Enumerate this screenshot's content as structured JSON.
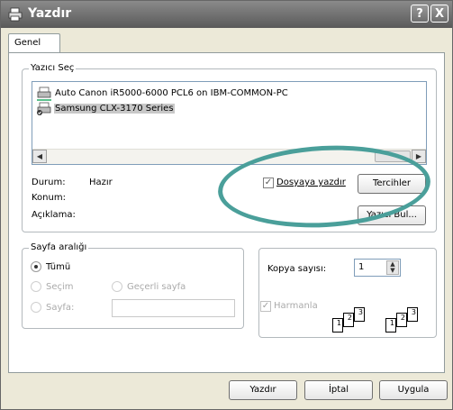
{
  "window": {
    "title": "Yazdır",
    "help_glyph": "?",
    "close_glyph": "X"
  },
  "tabs": [
    {
      "label": "Genel"
    }
  ],
  "printer_select": {
    "legend": "Yazıcı Seç",
    "printers": [
      {
        "name": "Auto Canon iR5000-6000 PCL6 on IBM-COMMON-PC",
        "selected": false
      },
      {
        "name": "Samsung CLX-3170 Series",
        "selected": true
      }
    ]
  },
  "status": {
    "status_label": "Durum:",
    "status_value": "Hazır",
    "location_label": "Konum:",
    "comment_label": "Açıklama:"
  },
  "print_to_file": {
    "label": "Dosyaya yazdır",
    "checked": true
  },
  "buttons": {
    "preferences": "Tercihler",
    "find_printer": "Yazıcı Bul...",
    "print": "Yazdır",
    "cancel": "İptal",
    "apply": "Uygula"
  },
  "page_range": {
    "legend": "Sayfa aralığı",
    "all": "Tümü",
    "selection": "Seçim",
    "current_page": "Geçerli sayfa",
    "pages": "Sayfa:",
    "selected": "all"
  },
  "copies": {
    "label": "Kopya sayısı:",
    "value": "1",
    "collate_label": "Harmanla",
    "collate_checked": true,
    "sheet_numbers": [
      "1",
      "2",
      "3"
    ]
  },
  "annotation": {
    "color": "#4a9f9a"
  }
}
